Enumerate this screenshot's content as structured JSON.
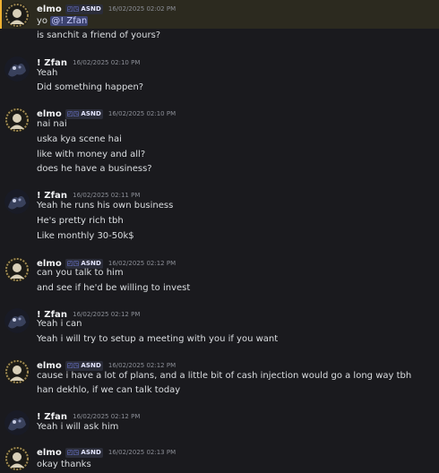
{
  "users": {
    "elmo": {
      "name": "elmo",
      "tag_icon": "◰◳",
      "tag": "ASND"
    },
    "zfan": {
      "name": "! Zfan"
    }
  },
  "messages": [
    {
      "author": "elmo",
      "timestamp": "16/02/2025 02:02 PM",
      "highlighted": true,
      "lines": [
        "yo",
        "is sanchit a friend of yours?"
      ],
      "mention": "@! Zfan"
    },
    {
      "author": "zfan",
      "timestamp": "16/02/2025 02:10 PM",
      "lines": [
        "Yeah",
        "Did something happen?"
      ]
    },
    {
      "author": "elmo",
      "timestamp": "16/02/2025 02:10 PM",
      "lines": [
        "nai nai",
        "uska kya scene hai",
        "like with money and all?",
        "does he have a business?"
      ]
    },
    {
      "author": "zfan",
      "timestamp": "16/02/2025 02:11 PM",
      "lines": [
        "Yeah he runs his own business",
        "He's pretty rich tbh",
        "Like monthly 30-50k$"
      ]
    },
    {
      "author": "elmo",
      "timestamp": "16/02/2025 02:12 PM",
      "lines": [
        "can you talk to him",
        "and see if he'd be willing to invest"
      ]
    },
    {
      "author": "zfan",
      "timestamp": "16/02/2025 02:12 PM",
      "lines": [
        "Yeah i can",
        "Yeah i will try to setup a meeting with you if you want"
      ]
    },
    {
      "author": "elmo",
      "timestamp": "16/02/2025 02:12 PM",
      "lines": [
        "cause i have a lot of plans, and a little bit of cash injection would go a long way tbh",
        "han dekhlo, if we can talk today"
      ]
    },
    {
      "author": "zfan",
      "timestamp": "16/02/2025 02:12 PM",
      "lines": [
        "Yeah i will ask him"
      ]
    },
    {
      "author": "elmo",
      "timestamp": "16/02/2025 02:13 PM",
      "lines": [
        "okay thanks"
      ]
    }
  ],
  "colors": {
    "background": "#1a1a1e",
    "highlight_bg": "#2c2a1f",
    "highlight_bar": "#f0b232",
    "mention_bg": "#3c4270",
    "username": "#f2f3f5",
    "timestamp": "#8b8e96",
    "text": "#dbdee1"
  }
}
